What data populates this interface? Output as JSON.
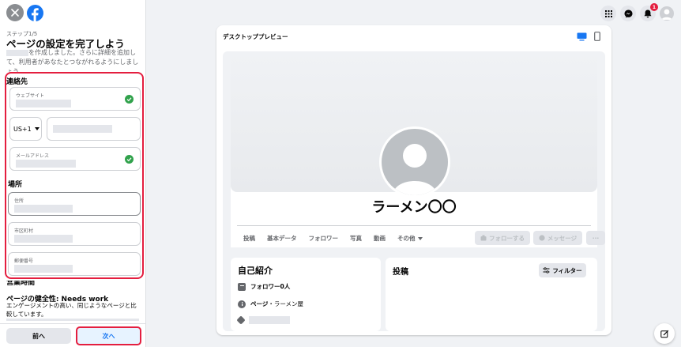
{
  "sidebar": {
    "step_label": "ステップ1/5",
    "title": "ページの設定を完了しよう",
    "description": "を作成しました。さらに詳細を追加して、利用者があなたとつながれるようにしましょう。",
    "contact_heading": "連絡先",
    "website_label": "ウェブサイト",
    "country_code": "US+1",
    "email_label": "メールアドレス",
    "location_heading": "場所",
    "address_label": "住所",
    "city_label": "市区町村",
    "zip_label": "郵便番号",
    "hours_heading": "営業時間",
    "health_title": "ページの健全性: Needs work",
    "health_desc": "エンゲージメントの高い、同じようなページと比較しています。",
    "health_progress": 0,
    "prev_label": "前へ",
    "next_label": "次へ"
  },
  "topbar": {
    "notification_count": "1",
    "icons": [
      "grid-menu-icon",
      "messenger-icon",
      "bell-icon",
      "account-avatar"
    ]
  },
  "preview": {
    "title": "デスクトッププレビュー",
    "page_name": "ラーメン〇〇",
    "tabs": [
      "投稿",
      "基本データ",
      "フォロワー",
      "写真",
      "動画",
      "その他"
    ],
    "follow_label": "フォローする",
    "message_label": "メッセージ",
    "more_label": "···",
    "intro": {
      "title": "自己紹介",
      "followers": "フォロワー0人",
      "page_prefix": "ページ",
      "category": "・ラーメン屋"
    },
    "posts_title": "投稿",
    "filter_label": "フィルター"
  },
  "colors": {
    "brand": "#1877f2",
    "highlight": "#e41e3f",
    "success": "#31a24c"
  }
}
